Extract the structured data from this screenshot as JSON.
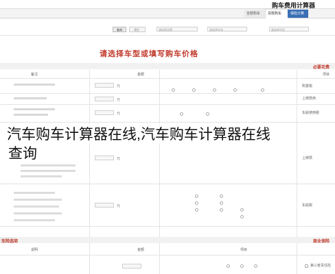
{
  "header": {
    "title": "购车费用计算器",
    "tabs": [
      "全款购车",
      "贷款购车",
      "保险计算"
    ],
    "active_tab": 1
  },
  "filters": {
    "query_button": "查询",
    "reset_button": "清空",
    "brand_placeholder": "请选择品牌",
    "series_placeholder": "请选择车系",
    "model_placeholder": "请选择车型"
  },
  "prompt": "请选择车型或填写购车价格",
  "sections": {
    "basic": "必要花费",
    "insurance": "商业保险",
    "options": "车险选项"
  },
  "table_headers": {
    "item": "项目",
    "amount": "金额",
    "note": "备注"
  },
  "rows": [
    {
      "label": "购置税",
      "unit": "元"
    },
    {
      "label": "上牌费用",
      "unit": "元"
    },
    {
      "label": "车船使用税",
      "unit": "元"
    },
    {
      "label": "交强险",
      "unit": "元"
    },
    {
      "label": "上牌费",
      "unit": "元"
    },
    {
      "label": "车船税",
      "unit": "元"
    }
  ],
  "overlay": {
    "line1": "汽车购车计算器在线,汽车购车计算器在线",
    "line2": "查询"
  },
  "bottom": {
    "headers": [
      "项目",
      "金额",
      "说明"
    ],
    "third_party_label": "第三者责任险"
  },
  "colors": {
    "accent": "#2f6db5",
    "red": "#c0392b",
    "tab_blue": "#3a6fb5"
  }
}
